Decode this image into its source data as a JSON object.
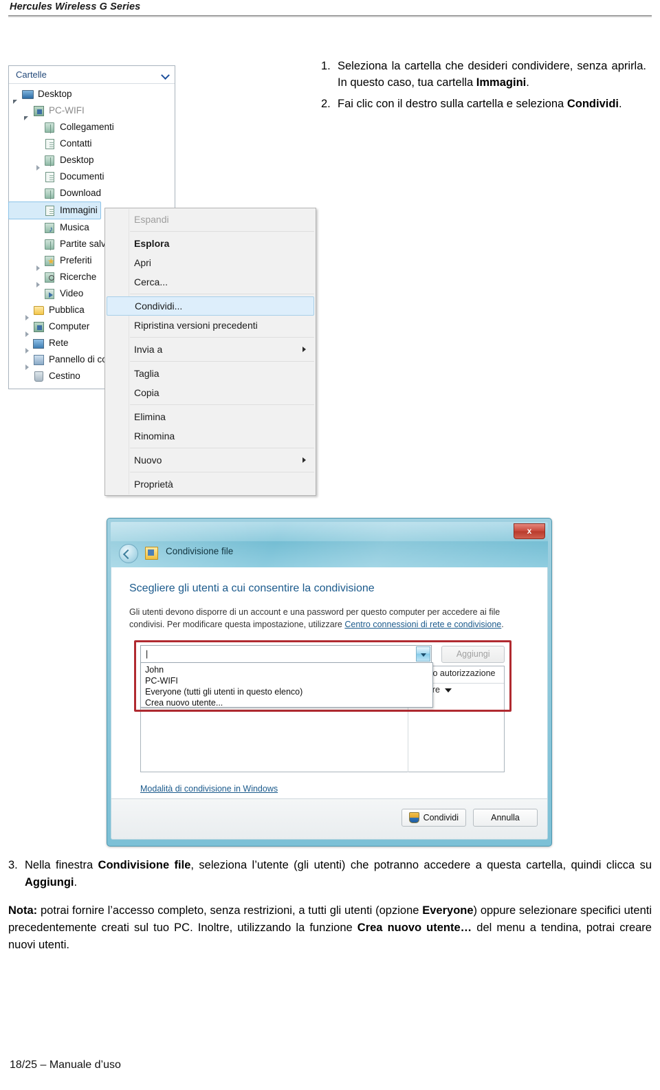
{
  "header": {
    "title": "Hercules Wireless G Series"
  },
  "steps_top": [
    {
      "num": "1.",
      "parts": [
        {
          "t": "Seleziona la cartella che desideri condividere, senza aprirla. In questo caso, tua cartella ",
          "b": false
        },
        {
          "t": "Immagini",
          "b": true
        },
        {
          "t": ".",
          "b": false
        }
      ]
    },
    {
      "num": "2.",
      "parts": [
        {
          "t": "Fai clic con il destro sulla cartella e seleziona ",
          "b": false
        },
        {
          "t": "Condividi",
          "b": true
        },
        {
          "t": ".",
          "b": false
        }
      ]
    }
  ],
  "explorer": {
    "panel_title": "Cartelle",
    "chevron_icon": "chevron-down-icon",
    "nodes": [
      {
        "label": "Desktop",
        "level": 0,
        "icon": "monitor-icon",
        "twist": "open",
        "state": "normal"
      },
      {
        "label": "PC-WIFI",
        "level": 1,
        "icon": "computer-icon",
        "twist": "open",
        "state": "dim"
      },
      {
        "label": "Collegamenti",
        "level": 2,
        "icon": "folder-icon",
        "twist": "none",
        "state": "normal"
      },
      {
        "label": "Contatti",
        "level": 2,
        "icon": "contacts-icon",
        "twist": "none",
        "state": "normal"
      },
      {
        "label": "Desktop",
        "level": 2,
        "icon": "folder-icon",
        "twist": "closed",
        "state": "normal"
      },
      {
        "label": "Documenti",
        "level": 2,
        "icon": "documents-icon",
        "twist": "none",
        "state": "normal"
      },
      {
        "label": "Download",
        "level": 2,
        "icon": "folder-icon",
        "twist": "none",
        "state": "normal"
      },
      {
        "label": "Immagini",
        "level": 2,
        "icon": "pictures-icon",
        "twist": "none",
        "state": "selected"
      },
      {
        "label": "Musica",
        "level": 2,
        "icon": "music-icon",
        "twist": "none",
        "state": "normal"
      },
      {
        "label": "Partite salvate",
        "level": 2,
        "icon": "folder-icon",
        "twist": "none",
        "state": "normal"
      },
      {
        "label": "Preferiti",
        "level": 2,
        "icon": "favorites-icon",
        "twist": "closed",
        "state": "normal"
      },
      {
        "label": "Ricerche",
        "level": 2,
        "icon": "searches-icon",
        "twist": "closed",
        "state": "normal"
      },
      {
        "label": "Video",
        "level": 2,
        "icon": "video-icon",
        "twist": "none",
        "state": "normal"
      },
      {
        "label": "Pubblica",
        "level": 1,
        "icon": "public-folder-icon",
        "twist": "closed",
        "state": "normal"
      },
      {
        "label": "Computer",
        "level": 1,
        "icon": "computer-icon",
        "twist": "closed",
        "state": "normal"
      },
      {
        "label": "Rete",
        "level": 1,
        "icon": "network-icon",
        "twist": "closed",
        "state": "normal"
      },
      {
        "label": "Pannello di controllo",
        "level": 1,
        "icon": "control-panel-icon",
        "twist": "closed",
        "state": "normal"
      },
      {
        "label": "Cestino",
        "level": 1,
        "icon": "recycle-bin-icon",
        "twist": "none",
        "state": "normal"
      }
    ]
  },
  "context_menu": {
    "items": [
      {
        "label": "Espandi",
        "style": "disabled",
        "sep_after": true,
        "arrow": false
      },
      {
        "label": "Esplora",
        "style": "bold",
        "sep_after": false,
        "arrow": false
      },
      {
        "label": "Apri",
        "style": "normal",
        "sep_after": false,
        "arrow": false
      },
      {
        "label": "Cerca...",
        "style": "normal",
        "sep_after": true,
        "arrow": false
      },
      {
        "label": "Condividi...",
        "style": "highlight",
        "sep_after": false,
        "arrow": false
      },
      {
        "label": "Ripristina versioni precedenti",
        "style": "normal",
        "sep_after": true,
        "arrow": false
      },
      {
        "label": "Invia a",
        "style": "normal",
        "sep_after": true,
        "arrow": true
      },
      {
        "label": "Taglia",
        "style": "normal",
        "sep_after": false,
        "arrow": false
      },
      {
        "label": "Copia",
        "style": "normal",
        "sep_after": true,
        "arrow": false
      },
      {
        "label": "Elimina",
        "style": "normal",
        "sep_after": false,
        "arrow": false
      },
      {
        "label": "Rinomina",
        "style": "normal",
        "sep_after": true,
        "arrow": false
      },
      {
        "label": "Nuovo",
        "style": "normal",
        "sep_after": true,
        "arrow": true
      },
      {
        "label": "Proprietà",
        "style": "normal",
        "sep_after": false,
        "arrow": false
      }
    ]
  },
  "dialog": {
    "title": "Condivisione file",
    "back_icon": "back-arrow-icon",
    "app_icon": "file-sharing-icon",
    "close_label": "x",
    "heading": "Scegliere gli utenti a cui consentire la condivisione",
    "description_1": "Gli utenti devono disporre di un account e una password per questo computer per accedere ai file",
    "description_2": "condivisi. Per modificare questa impostazione, utilizzare ",
    "description_link": "Centro connessioni di rete e condivisione",
    "description_end": ".",
    "combo_value": "",
    "combo_arrow_icon": "chevron-down-icon",
    "add_button": "Aggiungi",
    "dropdown_options": [
      "John",
      "PC-WIFI",
      "Everyone (tutti gli utenti in questo elenco)",
      "Crea nuovo utente..."
    ],
    "perm_col2_header": "Livello autorizzazione",
    "perm_row_value": "Lettore",
    "share_mode_link": "Modalità di condivisione in Windows",
    "share_button": "Condividi",
    "share_button_icon": "uac-shield-icon",
    "cancel_button": "Annulla",
    "accent_red": "#b02a30",
    "accent_blue": "#1b5a8c"
  },
  "steps_bottom": {
    "step3": {
      "num": "3.",
      "parts": [
        {
          "t": "Nella finestra ",
          "b": false
        },
        {
          "t": "Condivisione file",
          "b": true
        },
        {
          "t": ", seleziona l’utente (gli utenti) che potranno accedere a questa cartella, quindi clicca su ",
          "b": false
        },
        {
          "t": "Aggiungi",
          "b": true
        },
        {
          "t": ".",
          "b": false
        }
      ]
    },
    "note": {
      "parts": [
        {
          "t": "Nota:",
          "b": true
        },
        {
          "t": " potrai fornire l’accesso completo, senza restrizioni, a tutti gli utenti (opzione ",
          "b": false
        },
        {
          "t": "Everyone",
          "b": true
        },
        {
          "t": ") oppure selezionare specifici utenti precedentemente creati sul tuo PC. Inoltre, utilizzando la funzione ",
          "b": false
        },
        {
          "t": "Crea nuovo utente…",
          "b": true
        },
        {
          "t": " del menu a tendina, potrai creare nuovi utenti.",
          "b": false
        }
      ]
    }
  },
  "footer": {
    "text": "18/25 – Manuale d’uso"
  }
}
